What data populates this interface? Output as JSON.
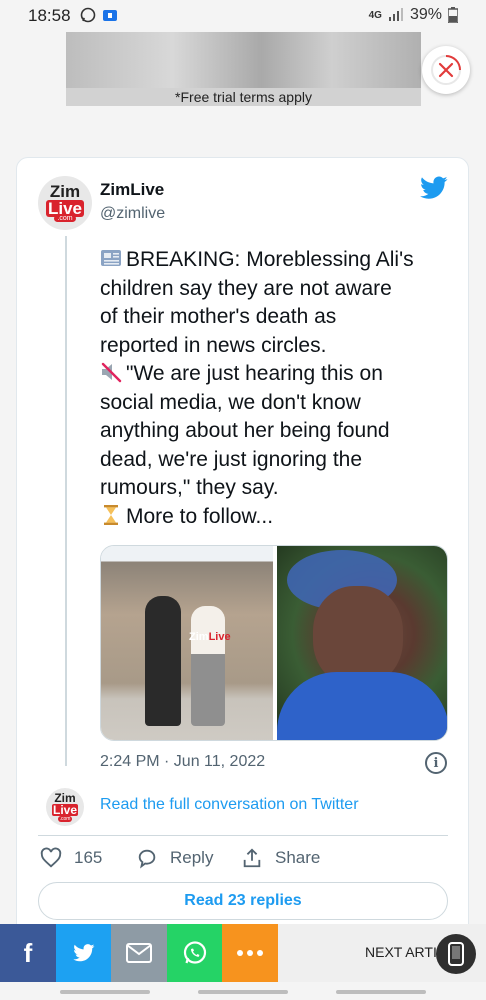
{
  "status_bar": {
    "time": "18:58",
    "network": "4G",
    "battery": "39%"
  },
  "ad": {
    "terms": "*Free trial terms apply"
  },
  "tweet": {
    "author_name": "ZimLive",
    "author_handle": "@zimlive",
    "avatar_text": {
      "top": "Zim",
      "bottom": "Live",
      "domain": ".com"
    },
    "text_lines": [
      "BREAKING: Moreblessing Ali's",
      "children say they are not aware",
      "of their mother's death as",
      "reported in news circles.",
      "\"We are just hearing this on",
      "social media, we don't know",
      "anything about her being found",
      "dead, we're just ignoring the",
      "rumours,\" they say.",
      "More to follow..."
    ],
    "photo_watermark": {
      "a": "Zim",
      "b": "Live"
    },
    "timestamp": "2:24 PM · Jun 11, 2022",
    "info_glyph": "i",
    "read_conversation": "Read the full conversation on Twitter",
    "likes": "165",
    "reply_label": "Reply",
    "share_label": "Share",
    "read_replies": "Read 23 replies"
  },
  "share_bar": {
    "facebook": "f",
    "next_article": "NEXT ARTIC",
    "colors": {
      "facebook": "#3b5998",
      "twitter": "#1da1f2",
      "email": "#8e9ba5",
      "whatsapp": "#25d366",
      "more": "#f7931e"
    }
  },
  "colors": {
    "accent": "#1d9bf0",
    "text": "#0f1419",
    "muted": "#536471",
    "brand_red": "#d9232d"
  }
}
